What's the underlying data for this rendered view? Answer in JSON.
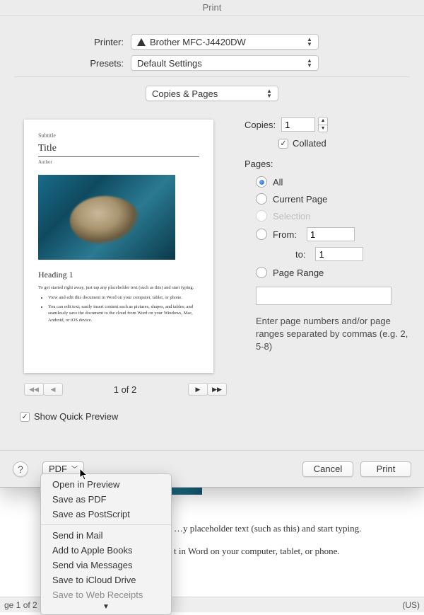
{
  "title": "Print",
  "printer": {
    "label": "Printer:",
    "value": "Brother MFC-J4420DW"
  },
  "presets": {
    "label": "Presets:",
    "value": "Default Settings"
  },
  "section": "Copies & Pages",
  "copies": {
    "label": "Copies:",
    "value": "1"
  },
  "collated": {
    "label": "Collated",
    "checked": true
  },
  "pages": {
    "label": "Pages:",
    "options": {
      "all": "All",
      "current": "Current Page",
      "selection": "Selection",
      "from": "From:",
      "to": "to:",
      "range": "Page Range"
    },
    "from_value": "1",
    "to_value": "1",
    "hint": "Enter page numbers and/or page ranges separated by commas (e.g. 2, 5-8)"
  },
  "preview": {
    "subtitle": "Subtitle",
    "title": "Title",
    "author": "Author",
    "heading": "Heading 1",
    "intro": "To get started right away, just tap any placeholder text (such as this) and start typing.",
    "bullet1": "View and edit this document in Word on your computer, tablet, or phone.",
    "bullet2": "You can edit text; easily insert content such as pictures, shapes, and tables; and seamlessly save the document to the cloud from Word on your Windows, Mac, Android, or iOS device.",
    "pager": "1 of 2"
  },
  "quick_preview": {
    "label": "Show Quick Preview",
    "checked": true
  },
  "buttons": {
    "help": "?",
    "pdf": "PDF",
    "cancel": "Cancel",
    "print": "Print"
  },
  "pdf_menu": {
    "group1": [
      "Open in Preview",
      "Save as PDF",
      "Save as PostScript"
    ],
    "group2": [
      "Send in Mail",
      "Add to Apple Books",
      "Send via Messages",
      "Save to iCloud Drive",
      "Save to Web Receipts"
    ]
  },
  "doc_bg": {
    "line1": "…y placeholder text (such as this) and start typing.",
    "line2": "t in Word on your computer, tablet, or phone."
  },
  "statusbar": {
    "page": "ge 1 of 2",
    "lang": "(US)"
  }
}
